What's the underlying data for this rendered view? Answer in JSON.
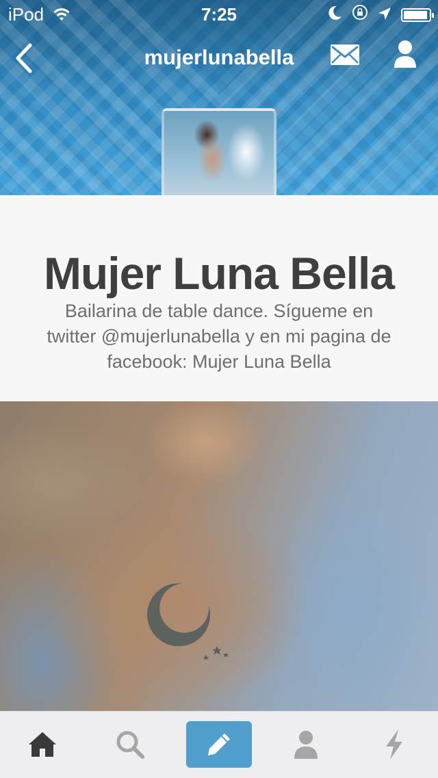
{
  "status_bar": {
    "carrier": "iPod",
    "time": "7:25",
    "battery_level": 0.95
  },
  "nav_bar": {
    "title": "mujerlunabella",
    "icons": [
      "back-chevron-icon",
      "mail-icon",
      "profile-icon"
    ]
  },
  "profile": {
    "name": "Mujer Luna Bella",
    "bio": "Bailarina de table dance. Sígueme en twitter @mujerlunabella y en mi pagina de facebook: Mujer Luna Bella"
  },
  "tab_bar": {
    "tabs": [
      "home-icon",
      "search-icon",
      "compose-icon",
      "account-icon",
      "activity-icon"
    ],
    "active": "compose-icon"
  },
  "colors": {
    "header_blue": "#3893cc",
    "compose_blue": "#529ecc",
    "name_text": "#3f3f3f",
    "bio_text": "#6e6e6e",
    "tab_icon": "#a6a6a6",
    "tab_icon_active": "#3a3a3a"
  }
}
